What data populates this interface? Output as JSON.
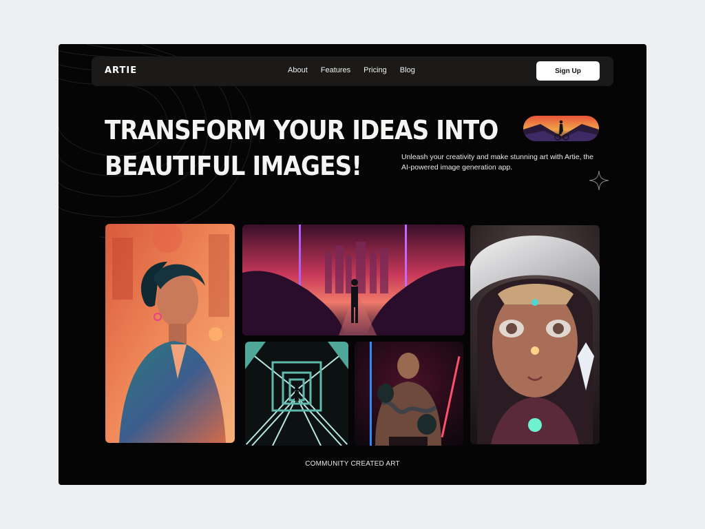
{
  "brand": {
    "logo": "ARTIE"
  },
  "nav": {
    "items": [
      {
        "label": "About"
      },
      {
        "label": "Features"
      },
      {
        "label": "Pricing"
      },
      {
        "label": "Blog"
      }
    ],
    "signup_label": "Sign Up"
  },
  "hero": {
    "title_line1": "TRANSFORM YOUR IDEAS INTO",
    "title_line2": "BEAUTIFUL IMAGES!",
    "description": "Unleash your creativity and make stunning art with Artie, the AI-powered image generation app."
  },
  "gallery": {
    "caption": "COMMUNITY CREATED ART"
  },
  "colors": {
    "background": "#eceef2",
    "frame": "#050505",
    "nav": "#1b1a18",
    "text": "#f4f4f2",
    "button": "#ffffff"
  }
}
